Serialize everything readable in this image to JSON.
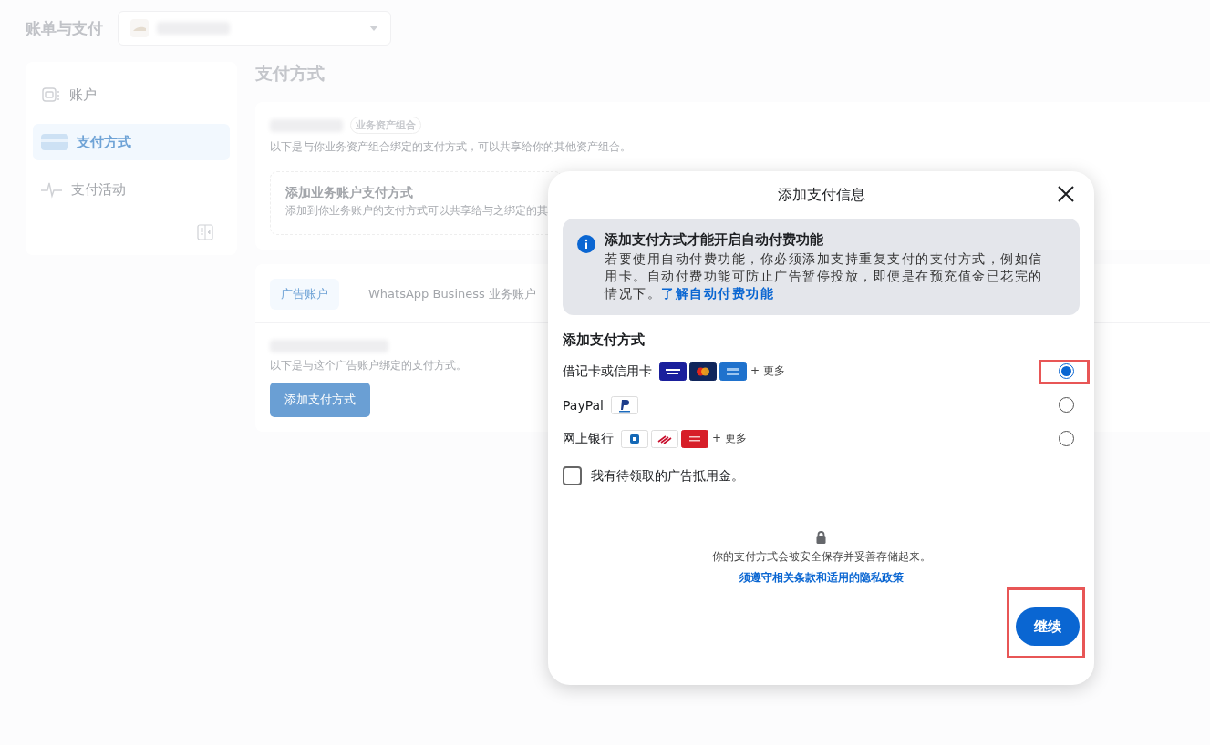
{
  "page_title": "账单与支付",
  "sidebar": {
    "items": [
      {
        "label": "账户",
        "selected": false
      },
      {
        "label": "支付方式",
        "selected": true
      },
      {
        "label": "支付活动",
        "selected": false
      }
    ]
  },
  "main": {
    "title": "支付方式",
    "business_card": {
      "badge": "业务资产组合",
      "description": "以下是与你业务资产组合绑定的支付方式，可以共享给你的其他资产组合。",
      "add_title": "添加业务账户支付方式",
      "add_description": "添加到你业务账户的支付方式可以共享给与之绑定的其"
    },
    "tabs": [
      {
        "label": "广告账户",
        "selected": true
      },
      {
        "label": "WhatsApp Business 业务账户",
        "selected": false
      }
    ],
    "ad_account": {
      "description": "以下是与这个广告账户绑定的支付方式。",
      "button": "添加支付方式"
    }
  },
  "dialog": {
    "title": "添加支付信息",
    "notice": {
      "title": "添加支付方式才能开启自动付费功能",
      "body": "若要使用自动付费功能，你必须添加支持重复支付的支付方式，例如信用卡。自动付费功能可防止广告暂停投放，即便是在预充值金已花完的情况下。",
      "link": "了解自动付费功能"
    },
    "section_title": "添加支付方式",
    "options": [
      {
        "label": "借记卡或信用卡",
        "more": "+ 更多",
        "selected": true,
        "highlighted": true
      },
      {
        "label": "PayPal",
        "selected": false,
        "highlighted": false
      },
      {
        "label": "网上银行",
        "more": "+ 更多",
        "selected": false,
        "highlighted": false
      }
    ],
    "ad_credit": {
      "label": "我有待领取的广告抵用金。",
      "checked": false
    },
    "security_note": "你的支付方式会被安全保存并妥善存储起来。",
    "terms_link": "须遵守相关条款和适用的隐私政策",
    "continue_button": {
      "label": "继续",
      "highlighted": true
    }
  }
}
